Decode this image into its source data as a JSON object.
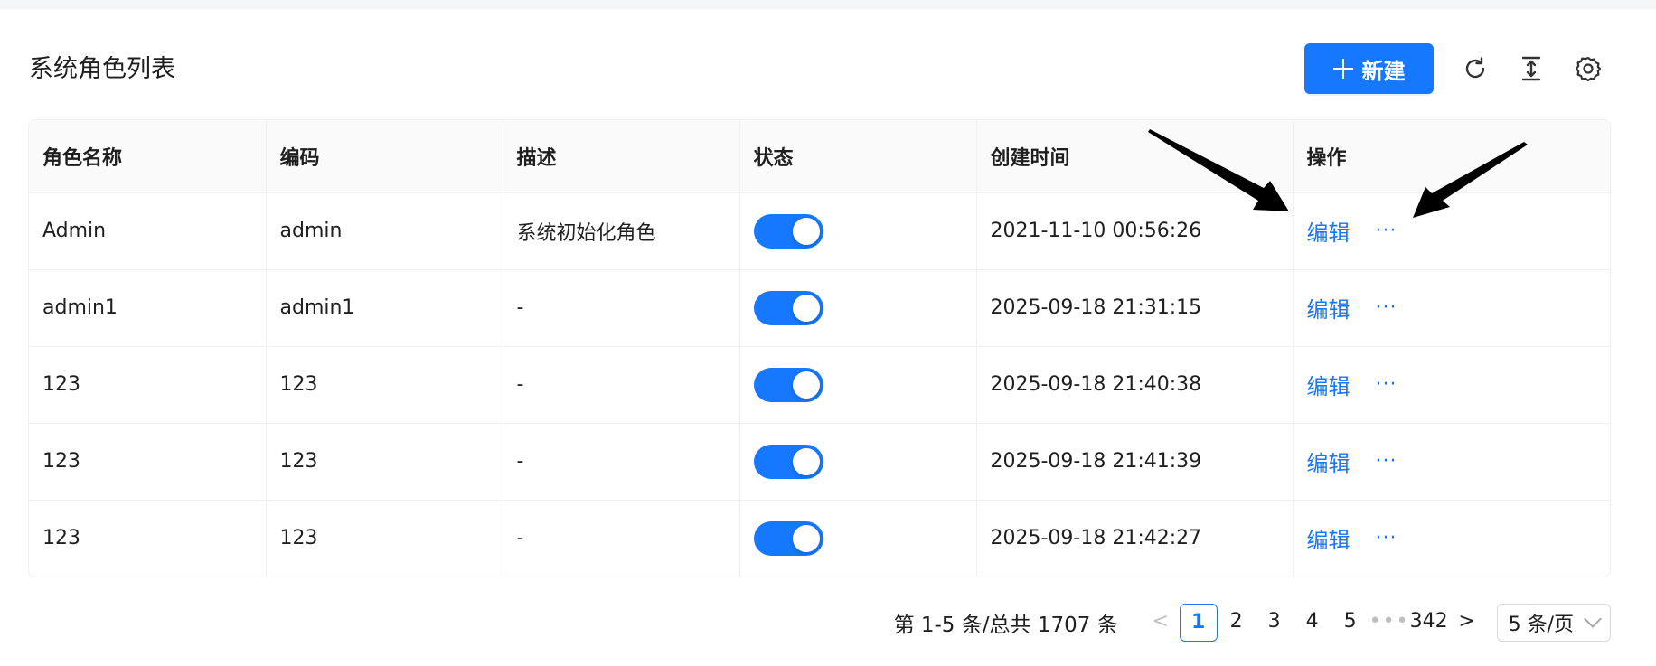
{
  "header": {
    "title": "系统角色列表",
    "new_button_label": "新建"
  },
  "toolbar_icons": [
    "reload-icon",
    "column-height-icon",
    "setting-icon"
  ],
  "table": {
    "columns": [
      "角色名称",
      "编码",
      "描述",
      "状态",
      "创建时间",
      "操作"
    ],
    "rows": [
      {
        "name": "Admin",
        "code": "admin",
        "desc": "系统初始化角色",
        "enabled": true,
        "created": "2021-11-10 00:56:26",
        "edit": "编辑",
        "more": "···"
      },
      {
        "name": "admin1",
        "code": "admin1",
        "desc": "-",
        "enabled": true,
        "created": "2025-09-18 21:31:15",
        "edit": "编辑",
        "more": "···"
      },
      {
        "name": "123",
        "code": "123",
        "desc": "-",
        "enabled": true,
        "created": "2025-09-18 21:40:38",
        "edit": "编辑",
        "more": "···"
      },
      {
        "name": "123",
        "code": "123",
        "desc": "-",
        "enabled": true,
        "created": "2025-09-18 21:41:39",
        "edit": "编辑",
        "more": "···"
      },
      {
        "name": "123",
        "code": "123",
        "desc": "-",
        "enabled": true,
        "created": "2025-09-18 21:42:27",
        "edit": "编辑",
        "more": "···"
      }
    ]
  },
  "pagination": {
    "total_text": "第 1-5 条/总共 1707 条",
    "prev": "<",
    "next": ">",
    "pages": [
      "1",
      "2",
      "3",
      "4",
      "5"
    ],
    "ellipsis": "•••",
    "last_page": "342",
    "current": "1",
    "page_size": "5 条/页"
  },
  "colors": {
    "primary": "#1677ff",
    "annotation": "#000000"
  }
}
